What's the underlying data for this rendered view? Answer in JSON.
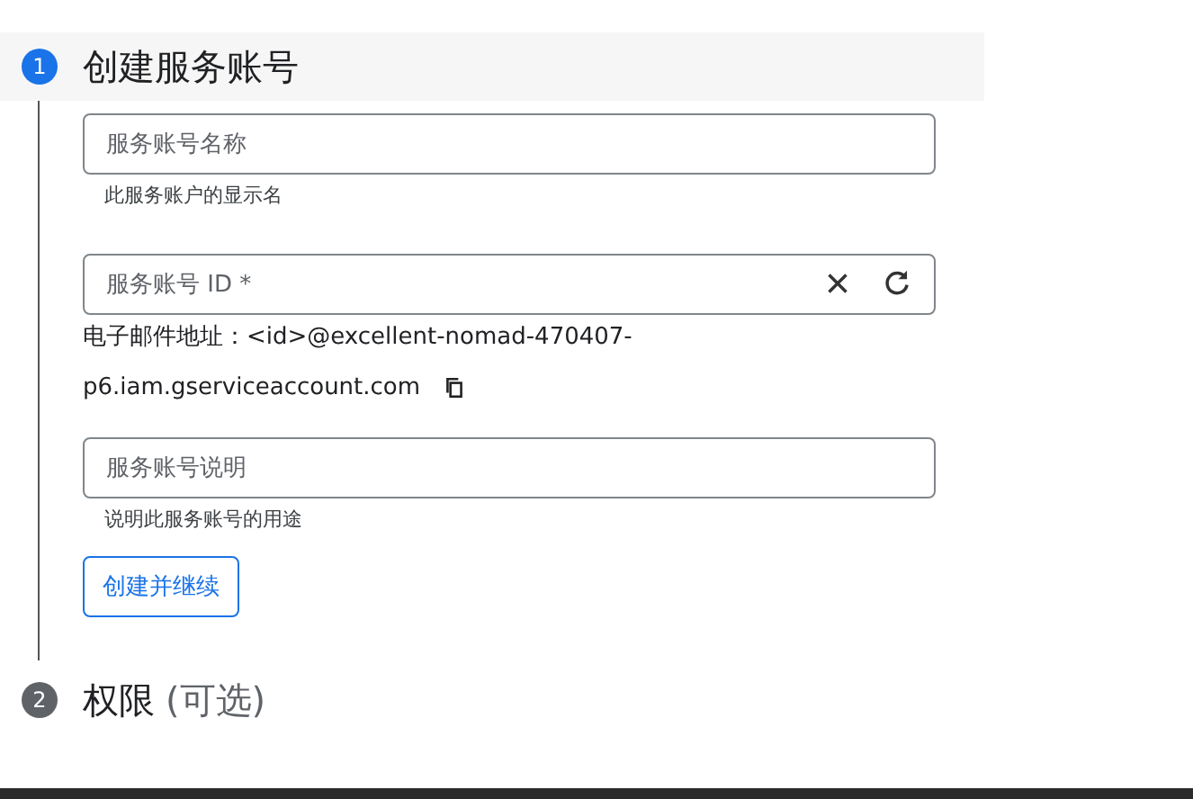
{
  "steps": [
    {
      "number": "1",
      "title": "创建服务账号",
      "active": true,
      "fields": [
        {
          "kind": "plain",
          "placeholder": "服务账号名称",
          "hint": "此服务账户的显示名"
        },
        {
          "kind": "id",
          "placeholder": "服务账号 ID *",
          "email": {
            "label": "电子邮件地址：",
            "line_1": "<id>@excellent-nomad-470407-",
            "line_2": "p6.iam.gserviceaccount.com"
          }
        },
        {
          "kind": "plain",
          "placeholder": "服务账号说明",
          "hint": "说明此服务账号的用途"
        }
      ],
      "button": "创建并继续"
    },
    {
      "number": "2",
      "title": "权限",
      "suffix": "(可选)",
      "active": false
    }
  ]
}
